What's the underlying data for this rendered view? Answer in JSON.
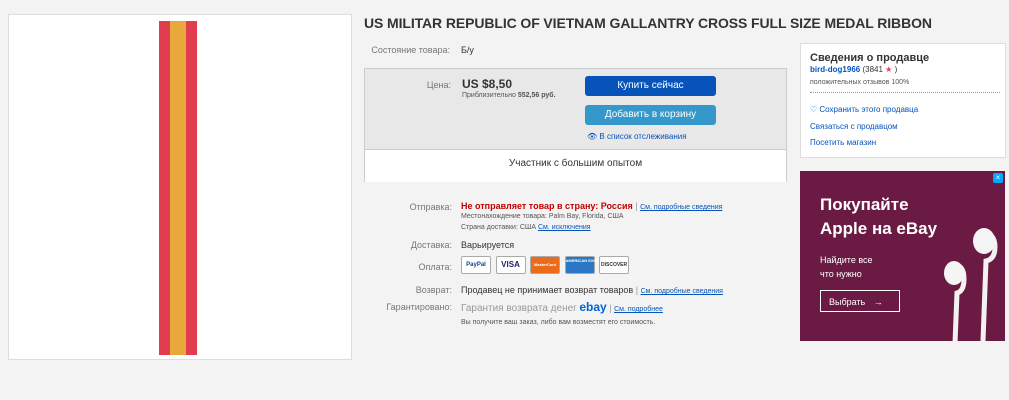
{
  "title": "US MILITAR REPUBLIC OF VIETNAM GALLANTRY CROSS FULL SIZE MEDAL RIBBON",
  "condition": {
    "label": "Состояние товара:",
    "value": "Б/у"
  },
  "price": {
    "label": "Цена:",
    "value": "US $8,50",
    "approx_prefix": "Приблизительно",
    "approx_value": "552,56 руб."
  },
  "buttons": {
    "buy": "Купить сейчас",
    "cart": "Добавить в корзину",
    "watch": "В список отслеживания"
  },
  "experience": "Участник с большим опытом",
  "shipping": {
    "label": "Отправка:",
    "value": "Не отправляет товар в страну: Россия",
    "sep": "|",
    "details_link": "См. подробные сведения",
    "location_label": "Местонахождение товара:",
    "location": "Palm Bay, Florida, США",
    "country_label": "Страна доставки:",
    "country": "США",
    "exceptions_link": "См. исключения"
  },
  "delivery": {
    "label": "Доставка:",
    "value": "Варьируется"
  },
  "payment": {
    "label": "Оплата:",
    "cards": [
      "PayPal",
      "VISA",
      "MasterCard",
      "AMERICAN EXPRESS",
      "DISCOVER"
    ]
  },
  "returns": {
    "label": "Возврат:",
    "value": "Продавец не принимает возврат товаров",
    "sep": "|",
    "link": "См. подробные сведения"
  },
  "guarantee": {
    "label": "Гарантировано:",
    "value": "Гарантия возврата денег",
    "brand": "ebay",
    "sep": "|",
    "link": "См. подробнее",
    "note": "Вы получите ваш заказ, либо вам возместят его стоимость."
  },
  "seller": {
    "heading": "Сведения о продавце",
    "name": "bird-dog1966",
    "score": "(3841",
    "score_end": ")",
    "feedback": "положительных отзывов 100%",
    "save": "Сохранить этого продавца",
    "contact": "Связаться с продавцом",
    "store": "Посетить магазин"
  },
  "ad": {
    "title1": "Покупайте",
    "title2": "Apple на eBay",
    "sub1": "Найдите все",
    "sub2": "что нужно",
    "button": "Выбрать"
  },
  "colors": {
    "ribbon_red": "#e23c51",
    "ribbon_gold": "#e8a93a",
    "buy_blue": "#0654ba",
    "cart_blue": "#3498ca",
    "ad_bg": "#6b1a43",
    "warning_red": "#c20000"
  }
}
